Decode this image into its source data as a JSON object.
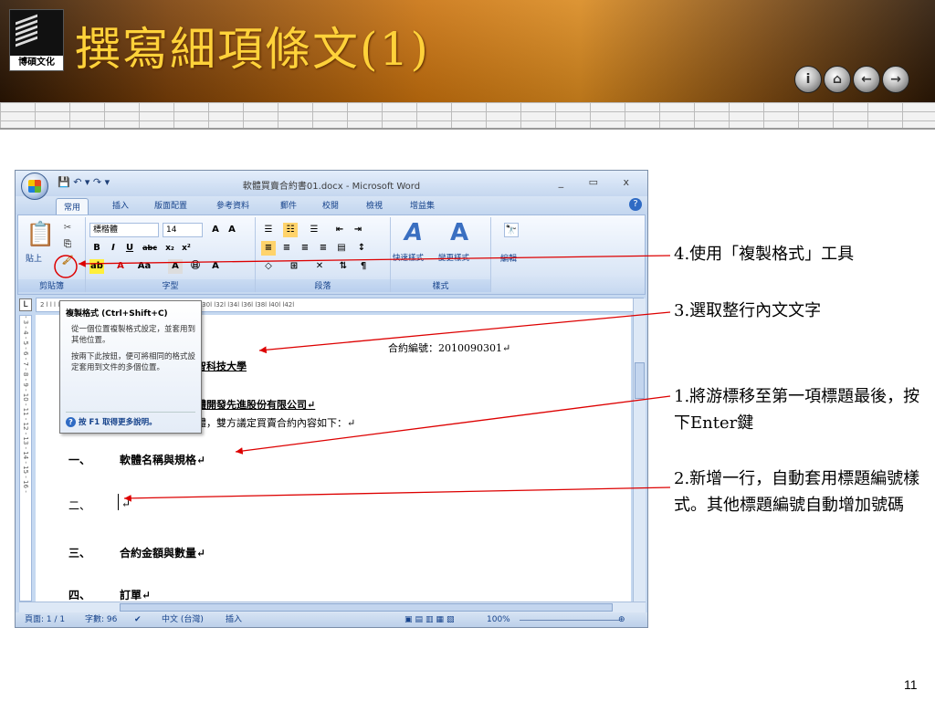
{
  "slide": {
    "title": "撰寫細項條文(1)",
    "logo_text": "博碩文化",
    "page_number": "11",
    "nav_buttons": [
      "i",
      "⌂",
      "←",
      "→"
    ]
  },
  "window": {
    "title": "軟體買賣合約書01.docx - Microsoft Word",
    "controls": "_ ▭ x",
    "help": "?",
    "qat": "💾 ↶ ▾ ↷ ▾",
    "tabs": [
      "常用",
      "插入",
      "版面配置",
      "參考資料",
      "郵件",
      "校閱",
      "檢視",
      "增益集"
    ],
    "ribbon": {
      "clipboard": {
        "paste": "貼上",
        "group": "剪貼簿"
      },
      "font": {
        "name": "標楷體",
        "size": "14",
        "group": "字型"
      },
      "paragraph": {
        "group": "段落"
      },
      "styles": {
        "quick": "快速樣式",
        "change": "變更樣式",
        "group": "樣式"
      },
      "editing": {
        "label": "編輯"
      }
    },
    "ruler_text": "2 l   l   l  l   l   l   l   l   l12l  l14l  l16l  l18l  l20l  l22l  l24l  l26l  l28l  l30l  l32l  l34l  l36l  l38l  l40l  l42l",
    "vruler_text": "- 3 - 4 - 5 - 6 - 7 - 8 - 9 - 10 - 11 - 12 - 13 - 14 - 15 - 16 -",
    "tooltip": {
      "title": "複製格式 (Ctrl+Shift+C)",
      "p1": "從一個位置複製格式設定，並套用到其他位置。",
      "p2": "按兩下此按鈕，便可將相同的格式設定套用到文件的多個位置。",
      "help": "按 F1 取得更多說明。"
    },
    "doc": {
      "contract_no": "合約編號：2010090301↵",
      "party_a": "智科技大學",
      "party_b": "體開發先進股份有限公司↵",
      "intro": "體，雙方議定買賣合約內容如下：↵",
      "items": [
        {
          "num": "一、",
          "text": "軟體名稱與規格↵"
        },
        {
          "num": "二、",
          "text": "↵"
        },
        {
          "num": "三、",
          "text": "合約金額與數量↵"
        },
        {
          "num": "四、",
          "text": "訂單↵"
        }
      ]
    },
    "status": {
      "page": "頁面: 1 / 1",
      "words": "字數: 96",
      "lang": "中文 (台灣)",
      "mode": "插入",
      "zoom": "100%"
    }
  },
  "annotations": [
    "4.使用「複製格式」工具",
    "3.選取整行內文文字",
    "1.將游標移至第一項標題最後，按下Enter鍵",
    "2.新增一行，自動套用標題編號樣式。其他標題編號自動增加號碼"
  ]
}
